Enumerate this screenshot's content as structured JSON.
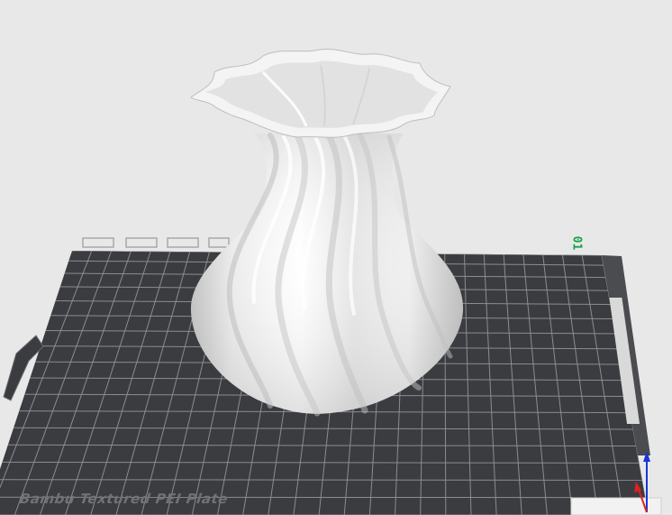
{
  "plate": {
    "label": "Bambu Textured PEI Plate",
    "number": "01",
    "grid_color": "#8a8d92",
    "plate_color": "#3a3c3f",
    "edge_color": "#4a4c50"
  },
  "model": {
    "kind": "vase",
    "color": "#f2f2f2"
  },
  "gizmo": {
    "x_color": "#e02020",
    "z_color": "#1a35d8"
  }
}
